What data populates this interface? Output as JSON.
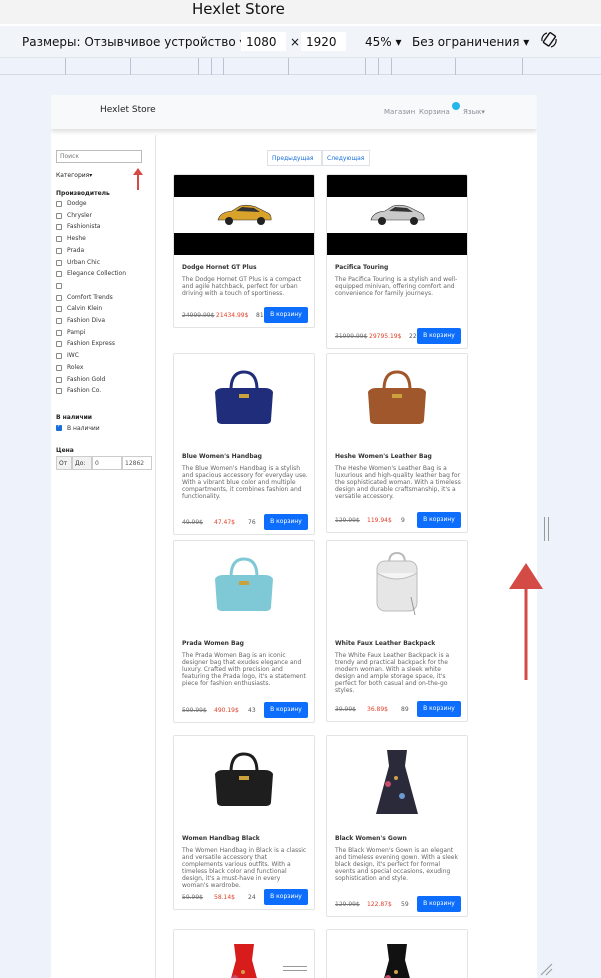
{
  "window": {
    "title": "Hexlet Store"
  },
  "devtools": {
    "dimensions_label": "Размеры: Отзывчивое устройство",
    "width": "1080",
    "height": "1920",
    "zoom": "45%",
    "throttle": "Без ограничения",
    "times": "×"
  },
  "nav": {
    "brand": "Hexlet Store",
    "links": [
      "Магазин",
      "Корзина",
      "Язык"
    ],
    "cart_badge_color": "#25b7e9"
  },
  "sidebar": {
    "search_placeholder": "Поиск",
    "category_label": "Категория",
    "maker_heading": "Производитель",
    "makers": [
      "Dodge",
      "Chrysler",
      "Fashionista",
      "Heshe",
      "Prada",
      "Urban Chic",
      "Elegance Collection",
      "",
      "Comfort Trends",
      "Calvin Klein",
      "Fashion Diva",
      "Pampi",
      "Fashion Express",
      "IWC",
      "Rolex",
      "Fashion Gold",
      "Fashion Co."
    ],
    "stock_heading": "В наличии",
    "stock_option": "В наличии",
    "stock_checked": true,
    "price_heading": "Цена",
    "price_from": "От",
    "price_to": "До:",
    "price_min": "0",
    "price_max": "12862"
  },
  "pager": {
    "prev": "Предыдущая",
    "next": "Следующая"
  },
  "products": [
    {
      "title": "Dodge Hornet GT Plus",
      "desc": "The Dodge Hornet GT Plus is a compact and agile hatchback, perfect for urban driving with a touch of sportiness.",
      "old": "24999.99$",
      "price": "21434.99$",
      "qty": "81",
      "btn": "В корзину",
      "image": "yellow-car",
      "color": "#d9a22a"
    },
    {
      "title": "Pacifica Touring",
      "desc": "The Pacifica Touring is a stylish and well-equipped minivan, offering comfort and convenience for family journeys.",
      "old": "31999.99$",
      "price": "29795.19$",
      "qty": "22",
      "btn": "В корзину",
      "image": "silver-car",
      "color": "#c9c9c9"
    },
    {
      "title": "Blue Women's Handbag",
      "desc": "The Blue Women's Handbag is a stylish and spacious accessory for everyday use. With a vibrant blue color and multiple compartments, it combines fashion and functionality.",
      "old": "49.99$",
      "price": "47.47$",
      "qty": "76",
      "btn": "В корзину",
      "image": "blue-bag",
      "color": "#1f2d7a"
    },
    {
      "title": "Heshe Women's Leather Bag",
      "desc": "The Heshe Women's Leather Bag is a luxurious and high-quality leather bag for the sophisticated woman. With a timeless design and durable craftsmanship, it's a versatile accessory.",
      "old": "129.99$",
      "price": "119.94$",
      "qty": "9",
      "btn": "В корзину",
      "image": "brown-bag",
      "color": "#a0572b"
    },
    {
      "title": "Prada Women Bag",
      "desc": "The Prada Women Bag is an iconic designer bag that exudes elegance and luxury. Crafted with precision and featuring the Prada logo, it's a statement piece for fashion enthusiasts.",
      "old": "599.99$",
      "price": "490.19$",
      "qty": "43",
      "btn": "В корзину",
      "image": "lightblue-bag",
      "color": "#7fc8d6"
    },
    {
      "title": "White Faux Leather Backpack",
      "desc": "The White Faux Leather Backpack is a trendy and practical backpack for the modern woman. With a sleek white design and ample storage space, it's perfect for both casual and on-the-go styles.",
      "old": "39.99$",
      "price": "36.89$",
      "qty": "89",
      "btn": "В корзину",
      "image": "white-backpack",
      "color": "#e6e6e6"
    },
    {
      "title": "Women Handbag Black",
      "desc": "The Women Handbag in Black is a classic and versatile accessory that complements various outfits. With a timeless black color and functional design, it's a must-have in every woman's wardrobe.",
      "old": "59.99$",
      "price": "58.14$",
      "qty": "24",
      "btn": "В корзину",
      "image": "black-bag",
      "color": "#1e1e1e"
    },
    {
      "title": "Black Women's Gown",
      "desc": "The Black Women's Gown is an elegant and timeless evening gown. With a sleek black design, it's perfect for formal events and special occasions, exuding sophistication and style.",
      "old": "129.99$",
      "price": "122.87$",
      "qty": "59",
      "btn": "В корзину",
      "image": "floral-dress",
      "color": "#2a2a3a"
    },
    {
      "title": "",
      "desc": "",
      "old": "",
      "price": "",
      "qty": "",
      "btn": "",
      "image": "red-dress",
      "color": "#d81b1b"
    },
    {
      "title": "",
      "desc": "",
      "old": "",
      "price": "",
      "qty": "",
      "btn": "",
      "image": "black-dress",
      "color": "#111111"
    }
  ],
  "annotations": {
    "arrow_color": "#d44a44"
  }
}
